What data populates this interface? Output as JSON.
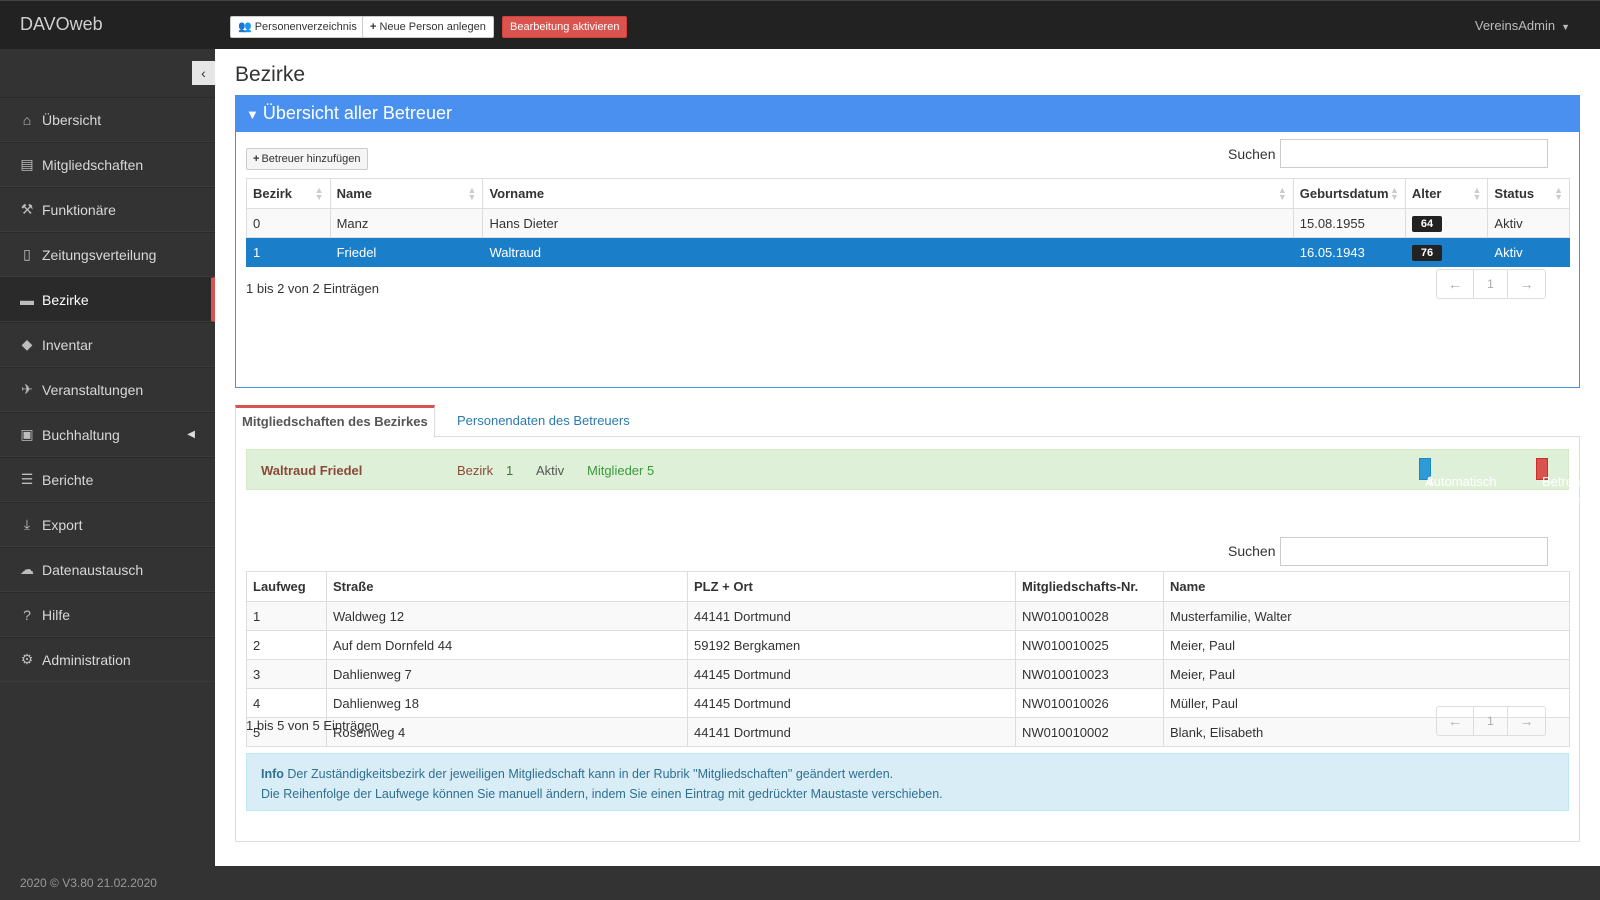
{
  "app": {
    "brand": "DAVOweb",
    "user": "VereinsAdmin"
  },
  "toolbar": {
    "directory_label": "Personenverzeichnis",
    "new_person_label": "Neue Person anlegen",
    "edit_label": "Bearbeitung aktivieren"
  },
  "sidebar": {
    "items": [
      {
        "label": "Übersicht",
        "icon": "home-icon"
      },
      {
        "label": "Mitgliedschaften",
        "icon": "book-icon"
      },
      {
        "label": "Funktionäre",
        "icon": "gavel-icon"
      },
      {
        "label": "Zeitungsverteilung",
        "icon": "file-icon"
      },
      {
        "label": "Bezirke",
        "icon": "briefcase-icon"
      },
      {
        "label": "Inventar",
        "icon": "tags-icon"
      },
      {
        "label": "Veranstaltungen",
        "icon": "plane-icon"
      },
      {
        "label": "Buchhaltung",
        "icon": "money-icon"
      },
      {
        "label": "Berichte",
        "icon": "list-icon"
      },
      {
        "label": "Export",
        "icon": "download-icon"
      },
      {
        "label": "Datenaustausch",
        "icon": "cloud-icon"
      },
      {
        "label": "Hilfe",
        "icon": "question-icon"
      },
      {
        "label": "Administration",
        "icon": "wrench-icon"
      }
    ],
    "version": "2020 © V3.80 21.02.2020"
  },
  "page": {
    "title": "Bezirke"
  },
  "betreuer": {
    "panel_title": "Übersicht aller Betreuer",
    "add_label": "Betreuer hinzufügen",
    "search_label": "Suchen",
    "columns": [
      "Bezirk",
      "Name",
      "Vorname",
      "Geburtsdatum",
      "Alter",
      "Status"
    ],
    "rows": [
      {
        "bezirk": "0",
        "name": "Manz",
        "vorname": "Hans Dieter",
        "geburtsdatum": "15.08.1955",
        "alter": "64",
        "status": "Aktiv"
      },
      {
        "bezirk": "1",
        "name": "Friedel",
        "vorname": "Waltraud",
        "geburtsdatum": "16.05.1943",
        "alter": "76",
        "status": "Aktiv"
      }
    ],
    "info": "1 bis 2 von 2 Einträgen",
    "pager": {
      "prev": "←",
      "page": "1",
      "next": "→"
    }
  },
  "tabs": {
    "active": "Mitgliedschaften des Bezirkes",
    "other": "Personendaten des Betreuers"
  },
  "detail": {
    "name": "Waltraud Friedel",
    "bezirk_label": "Bezirk",
    "bezirk_value": "1",
    "status": "Aktiv",
    "members": "Mitglieder 5",
    "sort_label": "Automatisch sortieren",
    "remove_label": "Betreuer entfernen",
    "search_label": "Suchen",
    "columns": [
      "Laufweg",
      "Straße",
      "PLZ + Ort",
      "Mitgliedschafts-Nr.",
      "Name"
    ],
    "rows": [
      {
        "laufweg": "1",
        "strasse": "Waldweg 12",
        "ort": "44141 Dortmund",
        "nr": "NW010010028",
        "name": "Musterfamilie, Walter"
      },
      {
        "laufweg": "2",
        "strasse": "Auf dem Dornfeld 44",
        "ort": "59192 Bergkamen",
        "nr": "NW010010025",
        "name": "Meier, Paul"
      },
      {
        "laufweg": "3",
        "strasse": "Dahlienweg 7",
        "ort": "44145 Dortmund",
        "nr": "NW010010023",
        "name": "Meier, Paul"
      },
      {
        "laufweg": "4",
        "strasse": "Dahlienweg 18",
        "ort": "44145 Dortmund",
        "nr": "NW010010026",
        "name": "Müller, Paul"
      },
      {
        "laufweg": "5",
        "strasse": "Rosenweg 4",
        "ort": "44141 Dortmund",
        "nr": "NW010010002",
        "name": "Blank, Elisabeth"
      }
    ],
    "info": "1 bis 5 von 5 Einträgen",
    "pager": {
      "prev": "←",
      "page": "1",
      "next": "→"
    }
  },
  "alert": {
    "title": "Info",
    "line1": "Der Zuständigkeitsbezirk der jeweiligen Mitgliedschaft kann in der Rubrik \"Mitgliedschaften\" geändert werden.",
    "line2": "Die Reihenfolge der Laufwege können Sie manuell ändern, indem Sie einen Eintrag mit gedrückter Maustaste verschieben."
  },
  "colors": {
    "primary": "#4a90f0",
    "danger": "#d9534f",
    "selected": "#1a7fc8",
    "success_bg": "#dff0d8",
    "info_bg": "#d9edf7"
  }
}
